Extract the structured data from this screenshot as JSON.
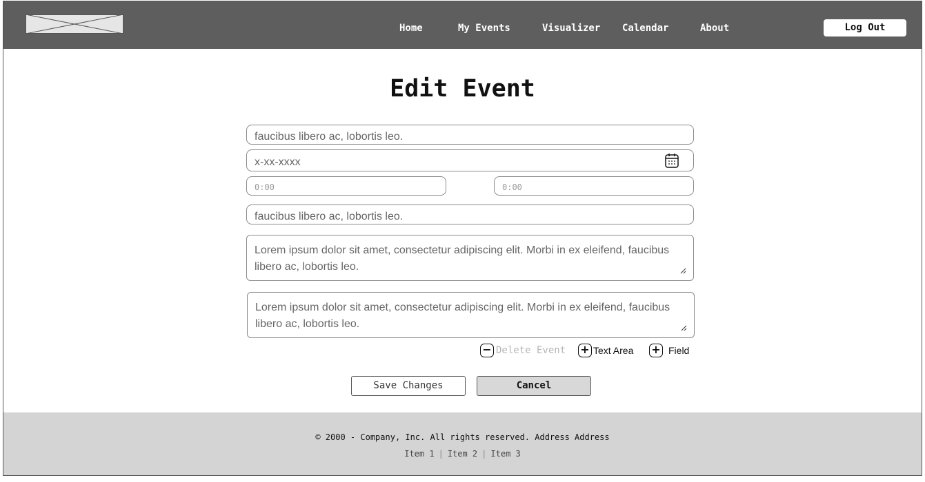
{
  "header": {
    "logo_icon": "image-placeholder-icon",
    "nav": [
      "Home",
      "My Events",
      "Visualizer",
      "Calendar",
      "About"
    ],
    "logout_label": "Log Out",
    "background": "#5e5e5e"
  },
  "form": {
    "title": "Edit Event",
    "name_value": "faucibus libero ac, lobortis leo.",
    "date_placeholder": "x-xx-xxxx",
    "date_icon": "calendar-icon",
    "start_time_placeholder": "0:00",
    "end_time_placeholder": "0:00",
    "location_value": "faucibus libero ac, lobortis leo.",
    "description_1": "Lorem ipsum dolor sit amet, consectetur adipiscing elit. Morbi in ex eleifend, faucibus libero ac, lobortis leo.",
    "description_2": "Lorem ipsum dolor sit amet, consectetur adipiscing elit. Morbi in ex eleifend, faucibus libero ac, lobortis leo."
  },
  "actions": {
    "delete_label": "Delete Event",
    "delete_icon": "minus-icon",
    "add_text_area_label": "Text Area",
    "add_text_area_icon": "plus-icon",
    "add_field_label": "Field",
    "add_field_icon": "plus-icon"
  },
  "buttons": {
    "save_label": "Save Changes",
    "cancel_label": "Cancel"
  },
  "footer": {
    "copyright": "© 2000 - Company, Inc. All rights reserved. Address Address",
    "links": [
      "Item 1",
      "Item 2",
      "Item 3"
    ],
    "background": "#d4d4d4"
  }
}
